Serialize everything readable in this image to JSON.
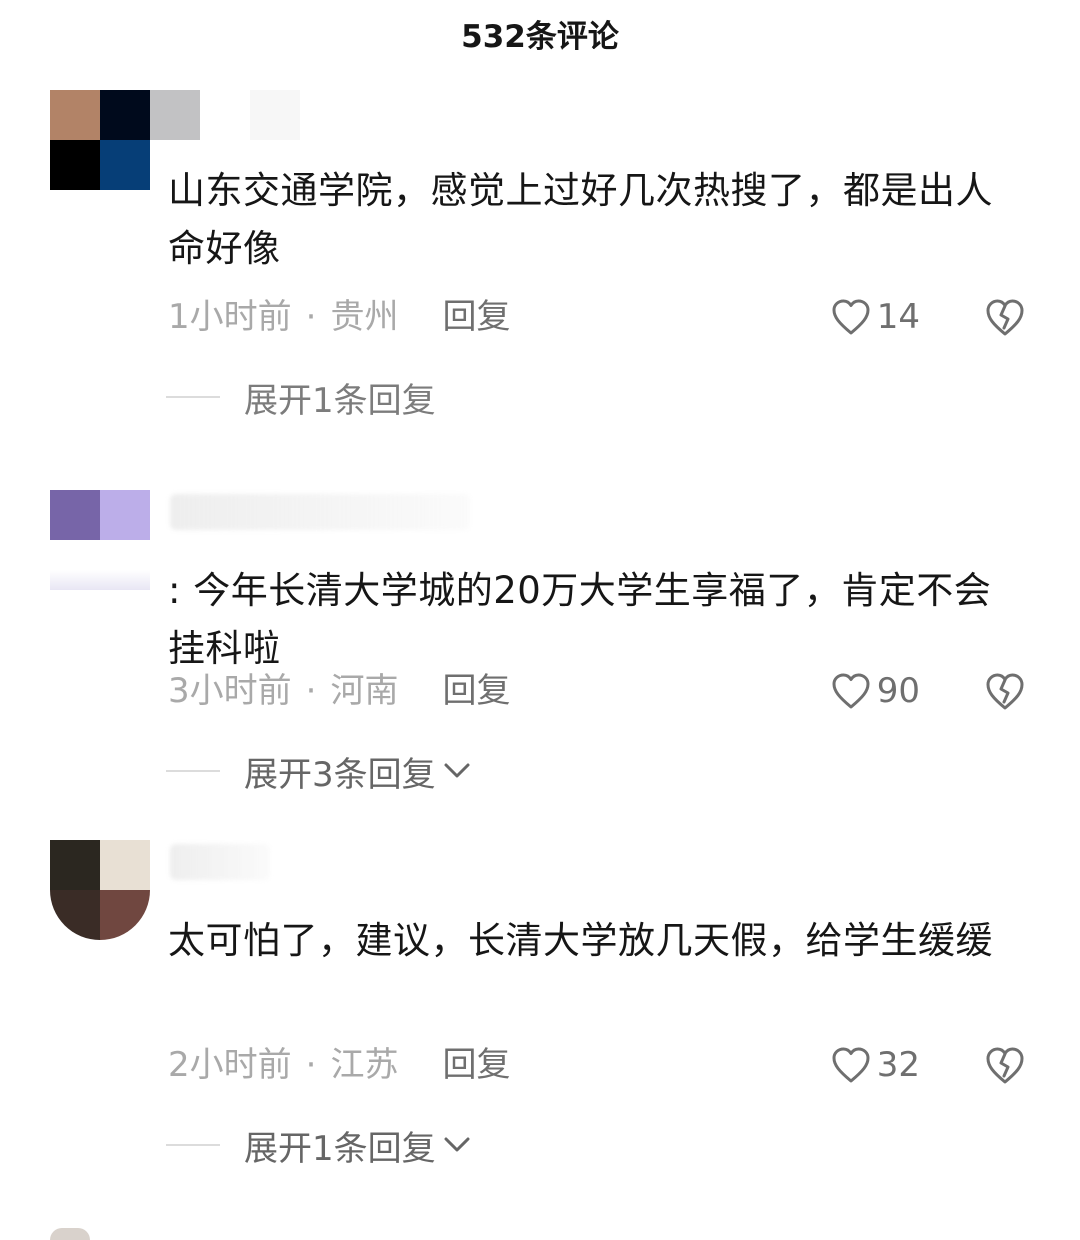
{
  "header": {
    "title": "532条评论"
  },
  "comments": [
    {
      "avatar_colors": [
        "#b28367",
        "#000a1c",
        "#c2c2c4",
        "#000000",
        "#063e77",
        "#ffffff"
      ],
      "text": "山东交通学院，感觉上过好几次热搜了，都是出人命好像",
      "time": "1小时前",
      "sep": "·",
      "location": "贵州",
      "reply_label": "回复",
      "likes": "14",
      "expand_label": "展开1条回复"
    },
    {
      "avatar_colors": [
        "#7765a8",
        "#bcaee9",
        "#ffffff",
        "#ffffff"
      ],
      "text": ": 今年长清大学城的20万大学生享福了，肯定不会挂科啦",
      "time": "3小时前",
      "sep": "·",
      "location": "河南",
      "reply_label": "回复",
      "likes": "90",
      "expand_label": "展开3条回复"
    },
    {
      "avatar_colors": [
        "#2b2720",
        "#e8e0d4",
        "#3a2c26",
        "#704740"
      ],
      "text": "太可怕了，建议，长清大学放几天假，给学生缓缓",
      "time": "2小时前",
      "sep": "·",
      "location": "江苏",
      "reply_label": "回复",
      "likes": "32",
      "expand_label": "展开1条回复"
    }
  ],
  "icons": {
    "like": "heart-outline-icon",
    "dislike": "broken-heart-icon",
    "expand": "chevron-down-icon"
  }
}
